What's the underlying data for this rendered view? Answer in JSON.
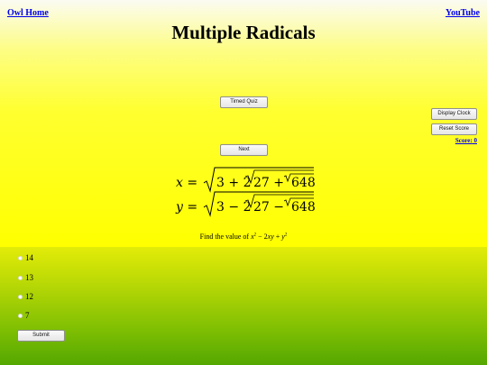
{
  "header": {
    "home_link": "Owl Home",
    "youtube_link": "YouTube",
    "title": "Multiple Radicals"
  },
  "controls": {
    "timed_quiz_label": "Timed Quiz",
    "next_label": "Next",
    "display_clock_label": "Display Clock",
    "reset_score_label": "Reset Score",
    "score_label": "Score:",
    "score_value": "0"
  },
  "problem": {
    "line1": {
      "var": "x",
      "eq": "=",
      "a": "3",
      "op1": "+",
      "coef": "2",
      "b": "27",
      "op2": "+",
      "c": "648"
    },
    "line2": {
      "var": "y",
      "eq": "=",
      "a": "3",
      "op1": "−",
      "coef": "2",
      "b": "27",
      "op2": "−",
      "c": "648"
    },
    "prompt_text": "Find the value of ",
    "prompt_x": "x",
    "prompt_exp": "2",
    "prompt_mid": " − 2",
    "prompt_xy": "xy",
    "prompt_plus": " + ",
    "prompt_y": "y",
    "prompt_exp2": "2"
  },
  "options": [
    "14",
    "13",
    "12",
    "7"
  ],
  "submit_label": "Submit",
  "colors": {
    "link": "#0000ee",
    "top_background": "#ffff00",
    "bottom_background": "#7fbf03"
  }
}
